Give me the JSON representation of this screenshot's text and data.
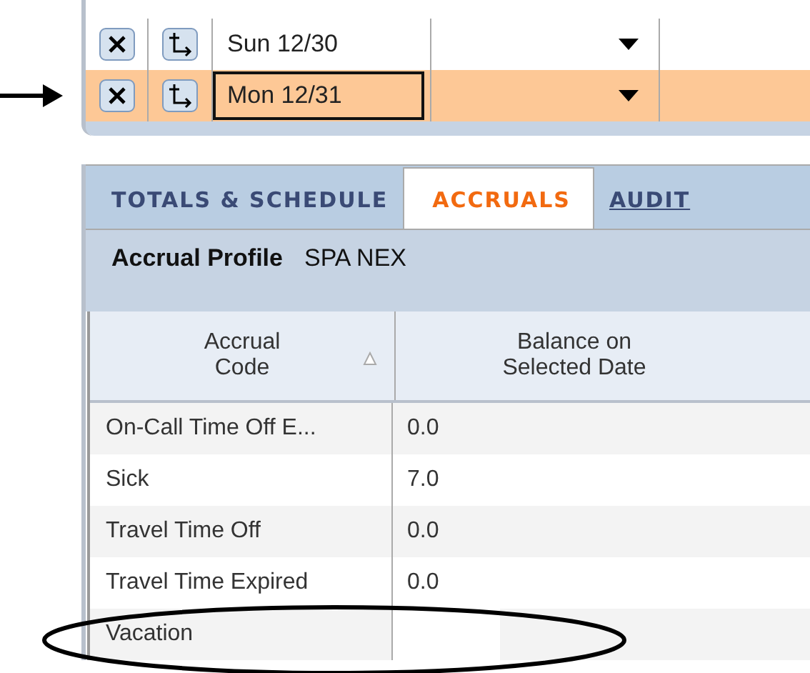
{
  "schedule_rows": [
    {
      "date": "Sun 12/30",
      "selected": false,
      "pointer": false
    },
    {
      "date": "Mon 12/31",
      "selected": true,
      "pointer": true
    }
  ],
  "tabs": [
    {
      "label": "TOTALS & SCHEDULE",
      "selected": false,
      "kind": "tab"
    },
    {
      "label": "ACCRUALS",
      "selected": true,
      "kind": "tab"
    },
    {
      "label": "AUDIT",
      "selected": false,
      "kind": "link"
    }
  ],
  "accrual_profile": {
    "label": "Accrual Profile",
    "value": "SPA NEX"
  },
  "columns": [
    "Accrual Code",
    "Balance on Selected Date"
  ],
  "rows": [
    {
      "code": "On-Call Time Off E...",
      "balance": "0.0",
      "circled": false
    },
    {
      "code": "Sick",
      "balance": "7.0",
      "circled": false
    },
    {
      "code": "Travel Time Off",
      "balance": "0.0",
      "circled": false
    },
    {
      "code": "Travel Time Expired",
      "balance": "0.0",
      "circled": false
    },
    {
      "code": "Vacation",
      "balance": "",
      "circled": true
    }
  ]
}
